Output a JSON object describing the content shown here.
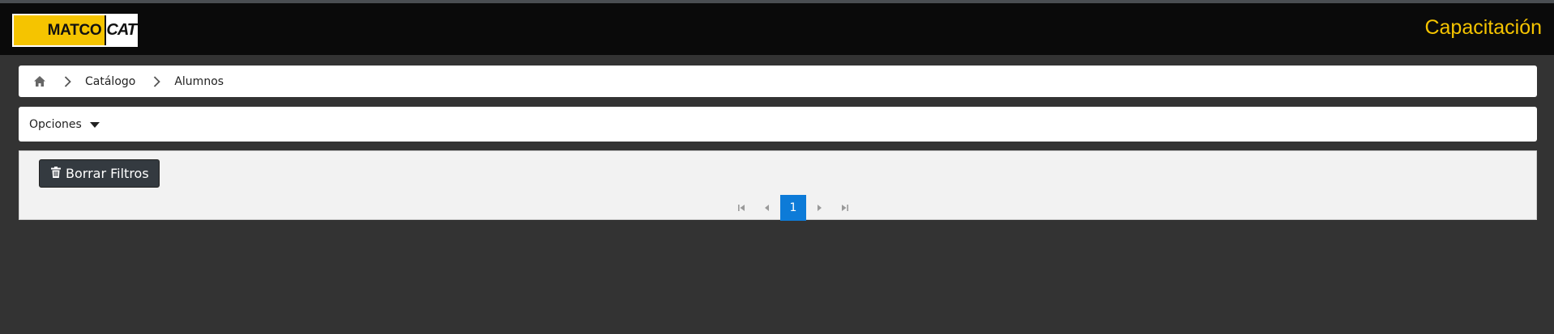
{
  "header": {
    "logo_matco": "MATCO",
    "logo_cat": "CAT",
    "app_title": "Capacitación"
  },
  "breadcrumb": {
    "items": [
      "Catálogo",
      "Alumnos"
    ]
  },
  "options": {
    "label": "Opciones"
  },
  "grid": {
    "clear_filters_label": "Borrar Filtros",
    "pager": {
      "current_page": "1"
    }
  },
  "colors": {
    "accent": "#f5c400",
    "pager_active": "#0d7bd8",
    "background": "#333333",
    "topbar": "#0a0a0a"
  },
  "icons": [
    "home-icon",
    "chevron-right-icon",
    "caret-down-icon",
    "trash-icon",
    "first-page-icon",
    "prev-page-icon",
    "next-page-icon",
    "last-page-icon"
  ]
}
